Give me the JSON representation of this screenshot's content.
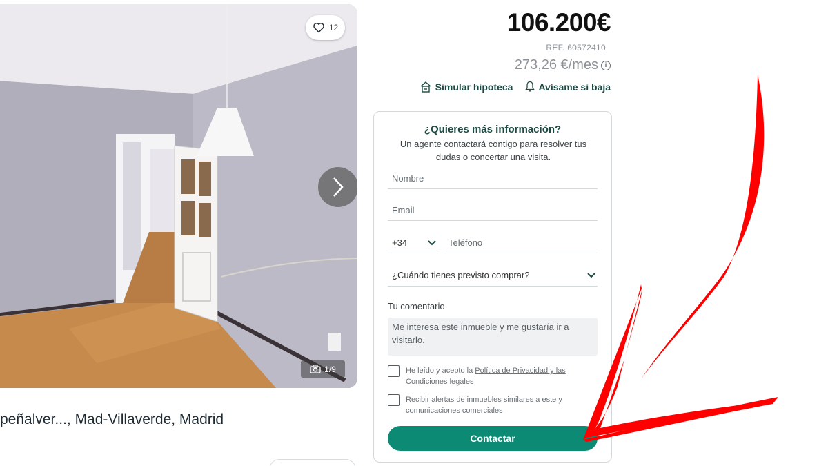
{
  "gallery": {
    "favorites_count": "12",
    "photo_counter": "1/9"
  },
  "listing": {
    "address": "peñalver..., Mad-Villaverde, Madrid"
  },
  "pricing": {
    "price": "106.200€",
    "reference": "REF. 60572410",
    "monthly": "273,26 €/mes",
    "links": [
      {
        "label": "Simular hipoteca",
        "icon": "calculator-house-icon"
      },
      {
        "label": "Avísame si baja",
        "icon": "bell-icon"
      }
    ]
  },
  "form": {
    "title": "¿Quieres más información?",
    "subtitle": "Un agente contactará contigo para resolver tus dudas o concertar una visita.",
    "name_placeholder": "Nombre",
    "email_placeholder": "Email",
    "phone_prefix": "+34",
    "phone_placeholder": "Teléfono",
    "purchase_select": "¿Cuándo tienes previsto comprar?",
    "comment_label": "Tu comentario",
    "comment_value": "Me interesa este inmueble y me gustaría ir a visitarlo.",
    "privacy_prefix": "He leído y acepto la ",
    "privacy_link": "Política de Privacidad y las Condiciones legales",
    "alerts_label": "Recibir alertas de inmuebles similares a este y comunicaciones comerciales",
    "submit_label": "Contactar"
  },
  "colors": {
    "brand_green": "#0d8a73",
    "dark_green_text": "#1c4a43",
    "annotation_red": "#ff0000"
  }
}
